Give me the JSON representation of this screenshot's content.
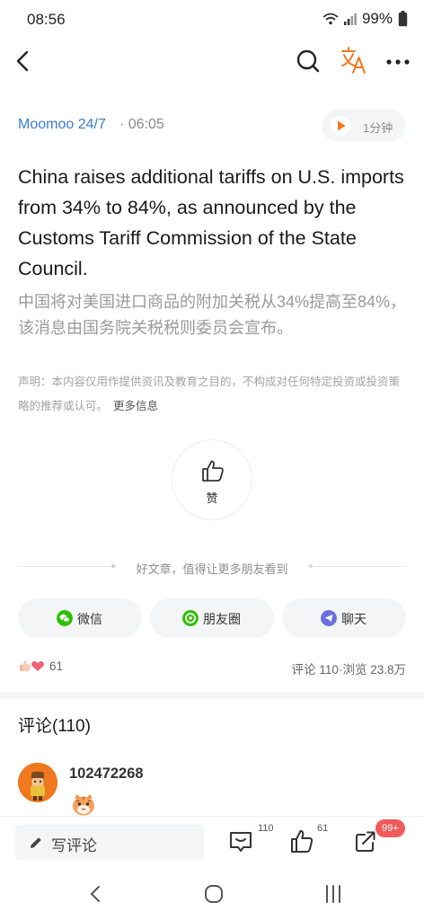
{
  "status_bar": {
    "time": "08:56",
    "battery": "99%",
    "icons": [
      "wifi-icon",
      "signal-icon",
      "battery-icon"
    ]
  },
  "nav": {
    "icons": [
      "back-arrow-icon",
      "search-icon",
      "translate-icon",
      "more-icon"
    ],
    "accent_color": "#f0781e"
  },
  "article": {
    "source": "Moomoo 24/7",
    "separator": "·",
    "time": "06:05",
    "audio_duration": "1分钟",
    "headline": "China raises additional tariffs on U.S. imports from 34% to 84%, as announced by the Customs Tariff Commission of the State Council.",
    "headline_cn": "中国将对美国进口商品的附加关税从34%提高至84%，该消息由国务院关税税则委员会宣布。",
    "disclaimer": "声明：本内容仅用作提供资讯及教育之目的，不构成对任何特定投资或投资策略的推荐或认可。",
    "more_info": "更多信息"
  },
  "like": {
    "label": "赞"
  },
  "share": {
    "prompt": "好文章，值得让更多朋友看到",
    "buttons": [
      {
        "label": "微信",
        "icon": "wechat-icon",
        "color": "#2dc100"
      },
      {
        "label": "朋友圈",
        "icon": "moments-icon",
        "color": "#2dc100"
      },
      {
        "label": "聊天",
        "icon": "chat-icon",
        "color": "#6c6fe0"
      }
    ]
  },
  "reactions": {
    "count": "61",
    "comments_label": "评论",
    "comments_count": "110",
    "dot": "·",
    "views_label": "浏览",
    "views_count": "23.8万"
  },
  "comments": {
    "title": "评论(110)",
    "items": [
      {
        "user": "102472268"
      }
    ]
  },
  "bottom_bar": {
    "write_label": "写评论",
    "comment_count": "110",
    "like_count": "61",
    "share_badge": "99+"
  }
}
